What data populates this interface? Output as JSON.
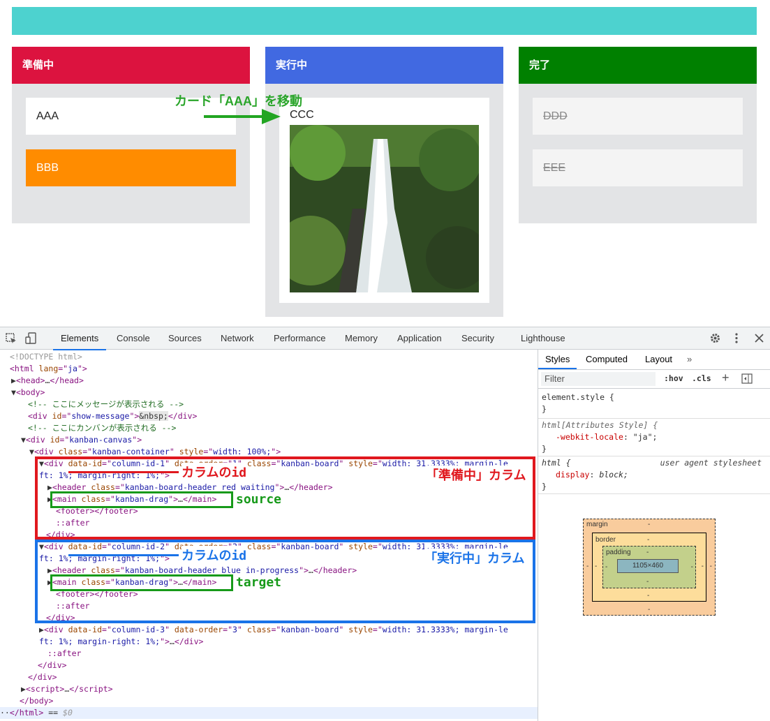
{
  "board": {
    "columns": [
      {
        "title": "準備中",
        "color": "#dc133f",
        "cards": [
          "AAA",
          "BBB"
        ]
      },
      {
        "title": "実行中",
        "color": "#4169e1",
        "cards": [
          "CCC"
        ]
      },
      {
        "title": "完了",
        "color": "#008000",
        "cards": [
          "DDD",
          "EEE"
        ]
      }
    ]
  },
  "annotations": {
    "move_card": "カード「AAA」を移動",
    "column_id_1": "カラムのid",
    "column_id_2": "カラムのid",
    "column_preparing": "「準備中」カラム",
    "column_running": "「実行中」カラム",
    "source": "source",
    "target": "target"
  },
  "devtools": {
    "tabs": [
      "Elements",
      "Console",
      "Sources",
      "Network",
      "Performance",
      "Memory",
      "Application",
      "Security",
      "Lighthouse"
    ],
    "side_tabs": [
      "Styles",
      "Computed",
      "Layout"
    ],
    "filter_placeholder": "Filter",
    "hov": ":hov",
    "cls": ".cls",
    "styles": {
      "element_style": "element.style {",
      "rule2_selector": "html[Attributes Style] {",
      "rule2_prop": "-webkit-locale",
      "rule2_val": "\"ja\";",
      "rule3_selector": "html {",
      "rule3_source": "user agent stylesheet",
      "rule3_prop": "display",
      "rule3_val": "block;"
    },
    "box": {
      "margin": "margin",
      "border": "border",
      "padding": "padding",
      "content": "1105×460",
      "dash": "-"
    }
  }
}
